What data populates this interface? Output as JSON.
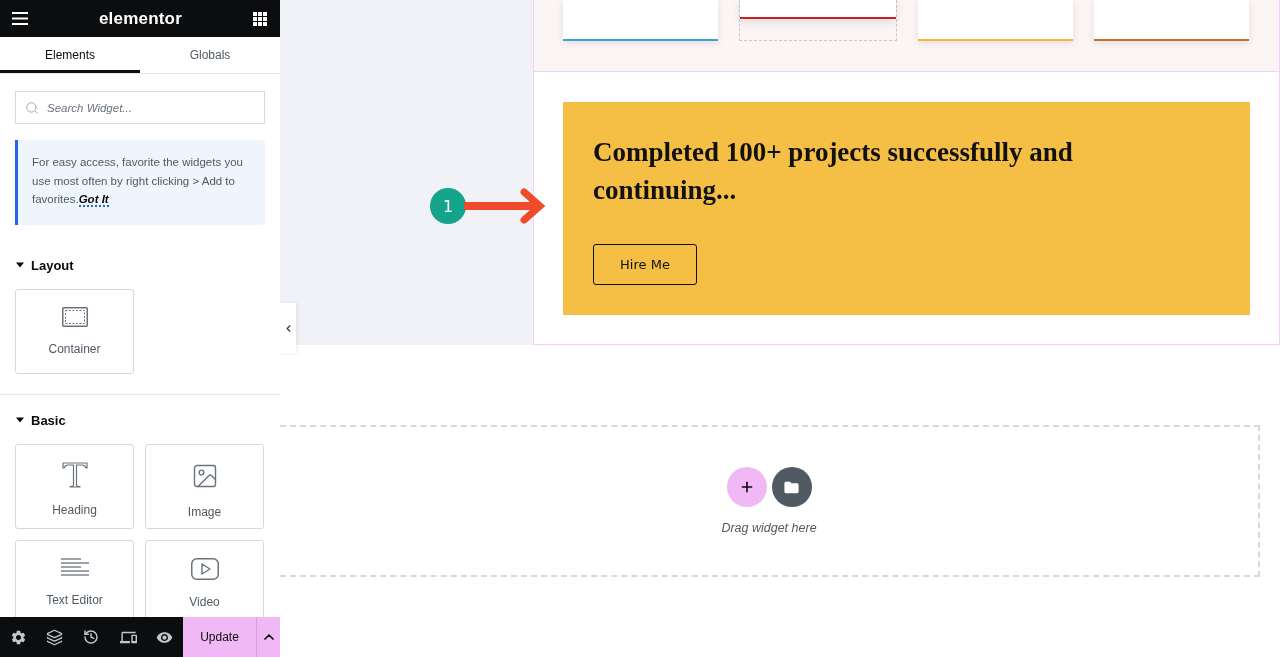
{
  "header": {
    "logo": "elementor"
  },
  "tabs": [
    {
      "label": "Elements",
      "selected": true
    },
    {
      "label": "Globals",
      "selected": false
    }
  ],
  "search": {
    "placeholder": "Search Widget..."
  },
  "tip": {
    "text": "For easy access, favorite the widgets you use most often by right clicking > Add to favorites.",
    "link": "Got It"
  },
  "categories": [
    {
      "title": "Layout",
      "expanded": true,
      "widgets": [
        {
          "kind": "container",
          "label": "Container"
        }
      ]
    },
    {
      "title": "Basic",
      "expanded": true,
      "widgets": [
        {
          "kind": "heading",
          "label": "Heading"
        },
        {
          "kind": "image",
          "label": "Image"
        },
        {
          "kind": "text",
          "label": "Text Editor"
        },
        {
          "kind": "video",
          "label": "Video"
        }
      ]
    }
  ],
  "footer": {
    "update_button": "Update"
  },
  "canvas": {
    "cards": [
      {
        "kind": "card",
        "color": "#3fa0d6"
      },
      {
        "kind": "raised",
        "color": "#c62121"
      },
      {
        "kind": "card",
        "color": "#f5b83d"
      },
      {
        "kind": "card",
        "color": "#c8702a"
      }
    ],
    "cta": {
      "heading": "Completed 100+ projects successfully and continuing...",
      "button": "Hire Me"
    },
    "annotation": {
      "number": "1"
    },
    "drop_zone": {
      "hint": "Drag widget here"
    }
  }
}
